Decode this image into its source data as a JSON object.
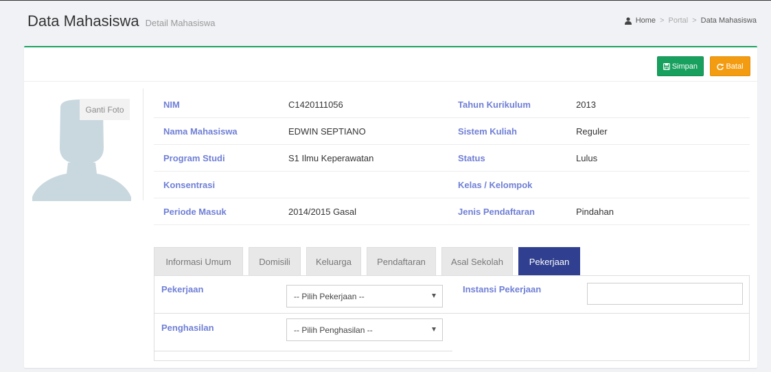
{
  "header": {
    "title": "Data Mahasiswa",
    "subtitle": "Detail Mahasiswa"
  },
  "breadcrumb": {
    "home": "Home",
    "portal": "Portal",
    "current": "Data Mahasiswa",
    "separator": ">"
  },
  "toolbar": {
    "save_label": "Simpan",
    "cancel_label": "Batal"
  },
  "photo": {
    "change_label": "Ganti Foto"
  },
  "info": {
    "rows": [
      {
        "label1": "NIM",
        "value1": "C1420111056",
        "label2": "Tahun Kurikulum",
        "value2": "2013"
      },
      {
        "label1": "Nama Mahasiswa",
        "value1": "EDWIN SEPTIANO",
        "label2": "Sistem Kuliah",
        "value2": "Reguler"
      },
      {
        "label1": "Program Studi",
        "value1": "S1 Ilmu Keperawatan",
        "label2": "Status",
        "value2": "Lulus"
      },
      {
        "label1": "Konsentrasi",
        "value1": "",
        "label2": "Kelas / Kelompok",
        "value2": ""
      },
      {
        "label1": "Periode Masuk",
        "value1": "2014/2015 Gasal",
        "label2": "Jenis Pendaftaran",
        "value2": "Pindahan"
      }
    ]
  },
  "tabs": [
    {
      "label": "Informasi Umum"
    },
    {
      "label": "Domisili"
    },
    {
      "label": "Keluarga"
    },
    {
      "label": "Pendaftaran"
    },
    {
      "label": "Asal Sekolah"
    },
    {
      "label": "Pekerjaan"
    }
  ],
  "pekerjaan": {
    "pekerjaan_label": "Pekerjaan",
    "pekerjaan_selected": "-- Pilih Pekerjaan --",
    "instansi_label": "Instansi Pekerjaan",
    "instansi_value": "",
    "penghasilan_label": "Penghasilan",
    "penghasilan_selected": "-- Pilih Penghasilan --"
  },
  "colors": {
    "accent_green": "#18a05e",
    "warning_orange": "#f39c12",
    "active_tab": "#303f8f",
    "label_blue": "#6f7fd6"
  }
}
